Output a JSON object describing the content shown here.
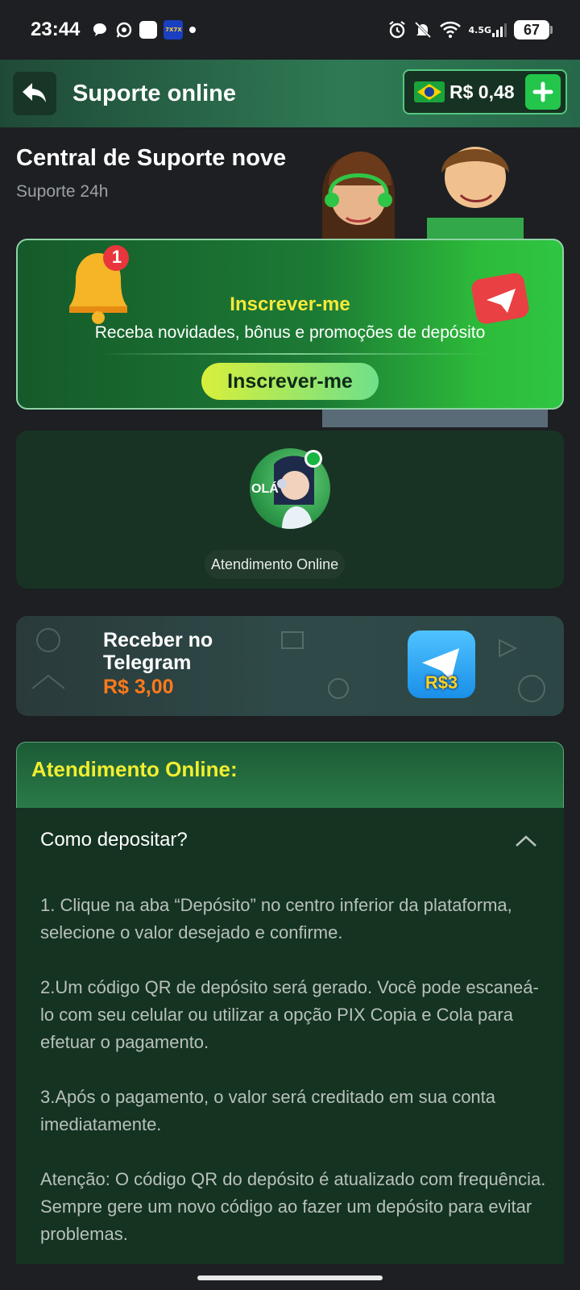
{
  "status_bar": {
    "time": "23:44",
    "app_icon_text": "7X7X",
    "network": "4.5G",
    "battery": "67"
  },
  "header": {
    "title": "Suporte online",
    "balance": "R$ 0,48"
  },
  "hero": {
    "title": "Central de Suporte nove",
    "subtitle": "Suporte 24h"
  },
  "subscribe": {
    "badge_count": "1",
    "title": "Inscrever-me",
    "description": "Receba novidades, bônus e promoções de depósito",
    "button_label": "Inscrever-me"
  },
  "attendant": {
    "avatar_text": "OLÁ",
    "label": "Atendimento Online"
  },
  "telegram": {
    "title": "Receber no Telegram",
    "amount": "R$ 3,00",
    "icon_text": "R$3"
  },
  "faq": {
    "section_title": "Atendimento Online:",
    "question": "Como depositar?",
    "answers": [
      "1. Clique na aba “Depósito” no centro inferior da plataforma, selecione o valor desejado e confirme.",
      "2.Um código QR de depósito será gerado. Você pode escaneá-lo com seu celular ou utilizar a opção PIX Copia e Cola para efetuar o pagamento.",
      "3.Após o pagamento, o valor será creditado em sua conta imediatamente.",
      "Atenção: O código QR do depósito é atualizado com frequência. Sempre gere um novo código ao fazer um depósito para evitar problemas."
    ]
  },
  "colors": {
    "accent_green": "#23c64b",
    "title_yellow": "#f2ee2f",
    "amount_orange": "#ff7a1a",
    "background": "#1d1f22"
  }
}
